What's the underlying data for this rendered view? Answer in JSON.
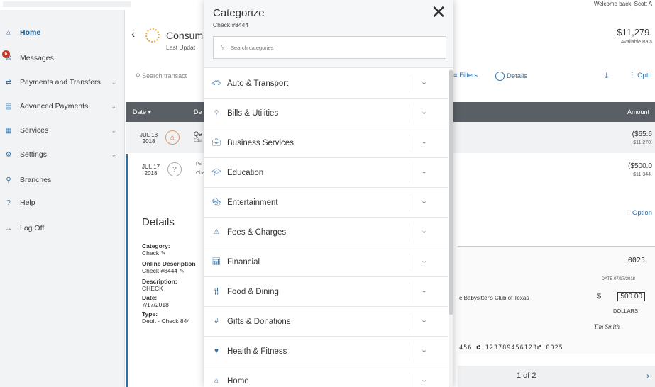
{
  "header": {
    "welcome": "Welcome back, Scott A"
  },
  "sidebar": {
    "items": [
      {
        "label": "Home",
        "icon": "home-icon"
      },
      {
        "label": "Messages",
        "icon": "mail-icon",
        "badge": "6"
      },
      {
        "label": "Payments and Transfers",
        "icon": "transfer-icon"
      },
      {
        "label": "Advanced Payments",
        "icon": "payments-icon"
      },
      {
        "label": "Services",
        "icon": "services-icon"
      },
      {
        "label": "Settings",
        "icon": "gear-icon"
      },
      {
        "label": "Branches",
        "icon": "location-icon"
      },
      {
        "label": "Help",
        "icon": "help-icon"
      },
      {
        "label": "Log Off",
        "icon": "logoff-icon"
      }
    ]
  },
  "account": {
    "name": "Consum",
    "updated": "Last Updat",
    "balance": "$11,279.",
    "balance_label": "Available Bala"
  },
  "toolbar": {
    "search_placeholder": "Search transact",
    "filters": "Filters",
    "details": "Details",
    "options": "Opti"
  },
  "table": {
    "col_date": "Date",
    "col_desc": "De",
    "col_amount": "Amount"
  },
  "transactions": [
    {
      "month_day": "JUL 18",
      "year": "2018",
      "desc1": "Qa",
      "desc2": "Edu",
      "amount": "($65.6",
      "balance": "$11,270."
    },
    {
      "month_day": "JUL 17",
      "year": "2018",
      "desc1": "PE",
      "desc2": "Che",
      "amount": "($500.0",
      "balance": "$11,344."
    }
  ],
  "details": {
    "title": "Details",
    "options": "Option",
    "category_label": "Category:",
    "category_value": "Check",
    "online_label": "Online Description",
    "online_value": "Check #8444",
    "desc_label": "Description:",
    "desc_value": "CHECK",
    "date_label": "Date:",
    "date_value": "7/17/2018",
    "type_label": "Type:",
    "type_value": "Debit - Check 844"
  },
  "check": {
    "number": "0025",
    "date_label": "DATE  07/17/2018",
    "payee": "e Babysitter's Club of Texas",
    "amount": "500.00",
    "dollars": "DOLLARS",
    "signature": "Tim Smith",
    "micr": "456 ⑆ 123789456123⑈ 0025"
  },
  "pager": {
    "text": "1 of 2"
  },
  "modal": {
    "title": "Categorize",
    "subtitle": "Check #8444",
    "search_placeholder": "Search categories",
    "categories": [
      {
        "label": "Auto & Transport",
        "icon": "car-icon"
      },
      {
        "label": "Bills & Utilities",
        "icon": "bulb-icon"
      },
      {
        "label": "Business Services",
        "icon": "briefcase-icon"
      },
      {
        "label": "Education",
        "icon": "grad-cap-icon"
      },
      {
        "label": "Entertainment",
        "icon": "ticket-icon"
      },
      {
        "label": "Fees & Charges",
        "icon": "warning-icon"
      },
      {
        "label": "Financial",
        "icon": "bar-chart-icon"
      },
      {
        "label": "Food & Dining",
        "icon": "dining-icon"
      },
      {
        "label": "Gifts & Donations",
        "icon": "gift-icon"
      },
      {
        "label": "Health & Fitness",
        "icon": "heart-icon"
      },
      {
        "label": "Home",
        "icon": "house-icon"
      }
    ]
  }
}
